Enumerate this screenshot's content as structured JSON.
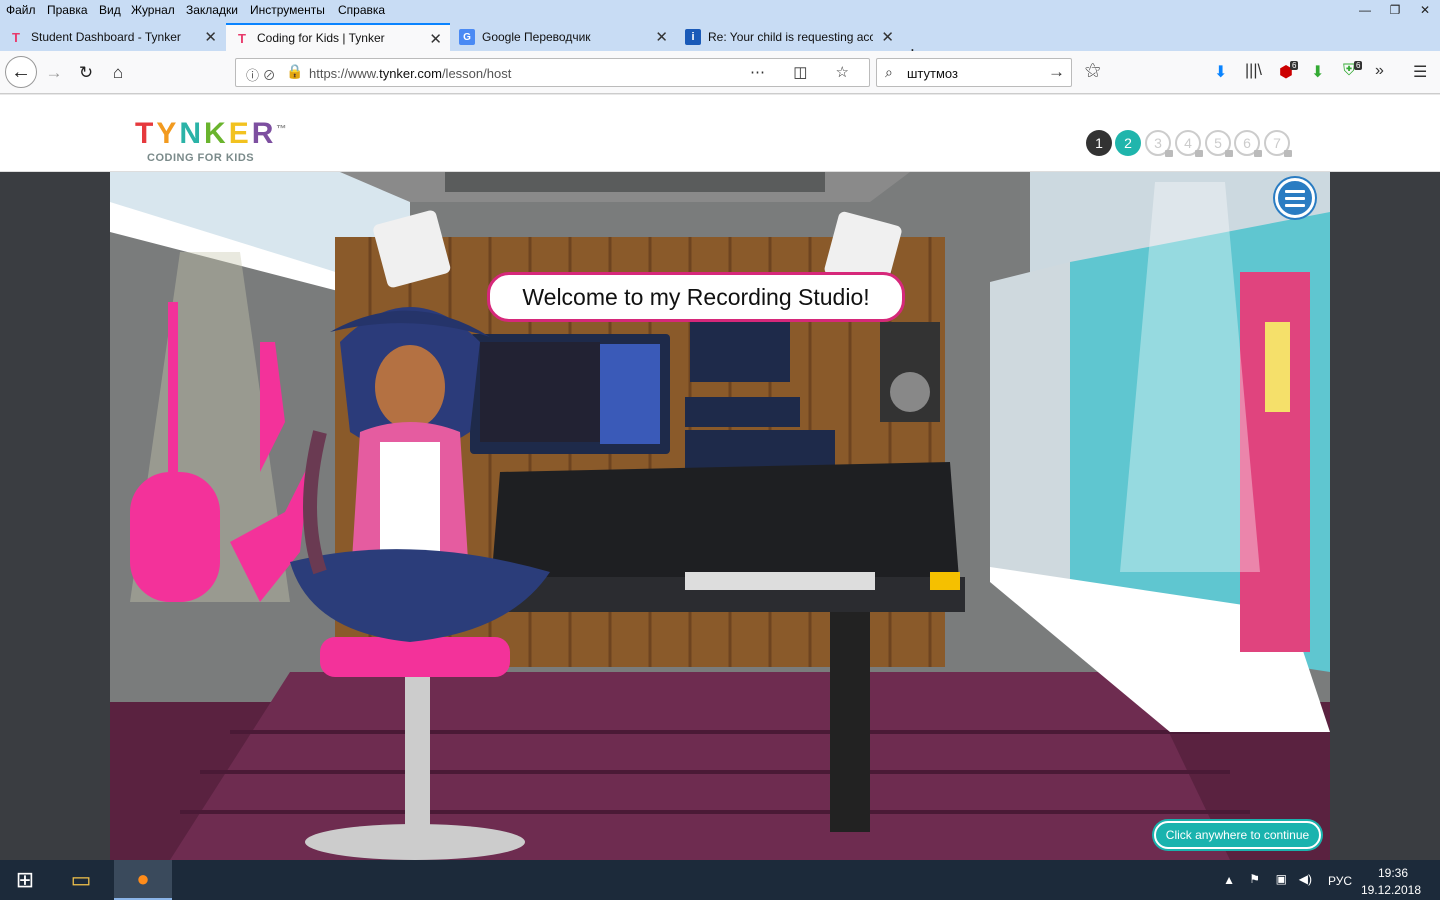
{
  "menu": [
    "Файл",
    "Правка",
    "Вид",
    "Журнал",
    "Закладки",
    "Инструменты",
    "Справка"
  ],
  "tabs": [
    {
      "title": "Student Dashboard - Tynker",
      "favicon": "tynker-icon"
    },
    {
      "title": "Coding for Kids | Tynker",
      "favicon": "tynker-icon"
    },
    {
      "title": "Google Переводчик",
      "favicon": "google-translate-icon"
    },
    {
      "title": "Re: Your child is requesting acc",
      "favicon": "info-icon"
    }
  ],
  "nav": {
    "url_prefix": "https://www.",
    "url_host": "tynker.com",
    "url_path": "/lesson/host",
    "search_value": "штутмоз",
    "badge1": "6",
    "badge2": "6"
  },
  "site": {
    "logo": "TYNKER",
    "logo_tm": "™",
    "tagline": "CODING FOR KIDS",
    "steps": [
      "1",
      "2",
      "3",
      "4",
      "5",
      "6",
      "7"
    ],
    "current_step": 2
  },
  "lesson": {
    "speech": "Welcome to my Recording Studio!",
    "continue": "Click anywhere to continue"
  },
  "taskbar": {
    "lang": "РУС",
    "time": "19:36",
    "date": "19.12.2018"
  },
  "colors": {
    "accent": "#1ab3ae",
    "pink": "#d6287a",
    "tab_highlight": "#0a84ff"
  }
}
